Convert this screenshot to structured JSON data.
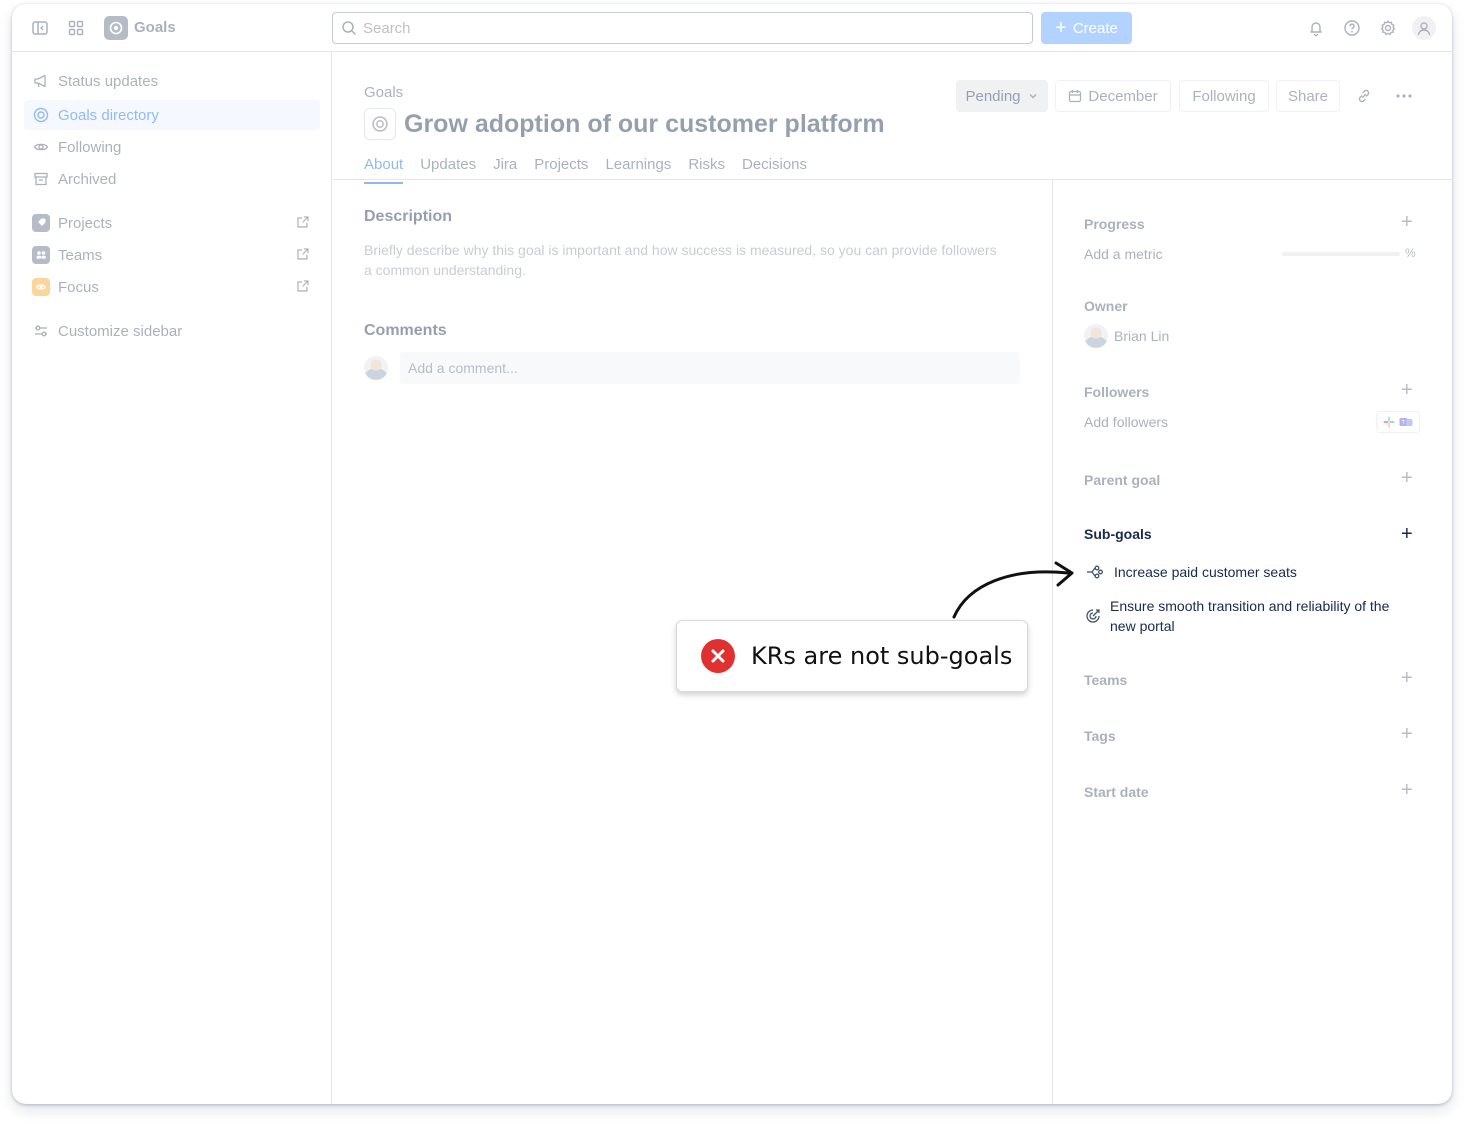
{
  "app": {
    "name": "Goals"
  },
  "search": {
    "placeholder": "Search"
  },
  "create": {
    "label": "Create"
  },
  "sidebar": {
    "items": [
      {
        "label": "Status updates",
        "icon": "megaphone-icon"
      },
      {
        "label": "Goals directory",
        "icon": "target-icon",
        "active": true
      },
      {
        "label": "Following",
        "icon": "eye-icon"
      },
      {
        "label": "Archived",
        "icon": "archive-icon"
      },
      {
        "label": "Projects",
        "icon": "rocket-icon"
      },
      {
        "label": "Teams",
        "icon": "people-icon"
      },
      {
        "label": "Focus",
        "icon": "focus-icon"
      },
      {
        "label": "Customize sidebar",
        "icon": "sliders-icon"
      }
    ]
  },
  "header": {
    "breadcrumb": "Goals",
    "title": "Grow adoption of our customer platform",
    "status": "Pending",
    "date": "December",
    "following": "Following",
    "share": "Share"
  },
  "tabs": [
    "About",
    "Updates",
    "Jira",
    "Projects",
    "Learnings",
    "Risks",
    "Decisions"
  ],
  "about": {
    "description_title": "Description",
    "description_placeholder": "Briefly describe why this goal is important and how success is measured, so you can provide followers a common understanding.",
    "comments_title": "Comments",
    "comment_placeholder": "Add a comment..."
  },
  "panel": {
    "progress": {
      "label": "Progress",
      "value": "Add a metric",
      "unit": "%",
      "level": 0
    },
    "owner": {
      "label": "Owner",
      "name": "Brian Lin"
    },
    "followers": {
      "label": "Followers",
      "value": "Add followers"
    },
    "parent_goal": {
      "label": "Parent goal"
    },
    "subgoals": {
      "label": "Sub-goals",
      "items": [
        {
          "label": "Increase paid customer seats",
          "icon": "branch-goal-icon"
        },
        {
          "label": "Ensure smooth transition and reliability of the new portal",
          "icon": "target-arrow-icon"
        }
      ]
    },
    "teams": {
      "label": "Teams"
    },
    "tags": {
      "label": "Tags"
    },
    "start_date": {
      "label": "Start date"
    }
  },
  "callout": {
    "text": "KRs are not sub-goals",
    "color": "#e03131"
  }
}
